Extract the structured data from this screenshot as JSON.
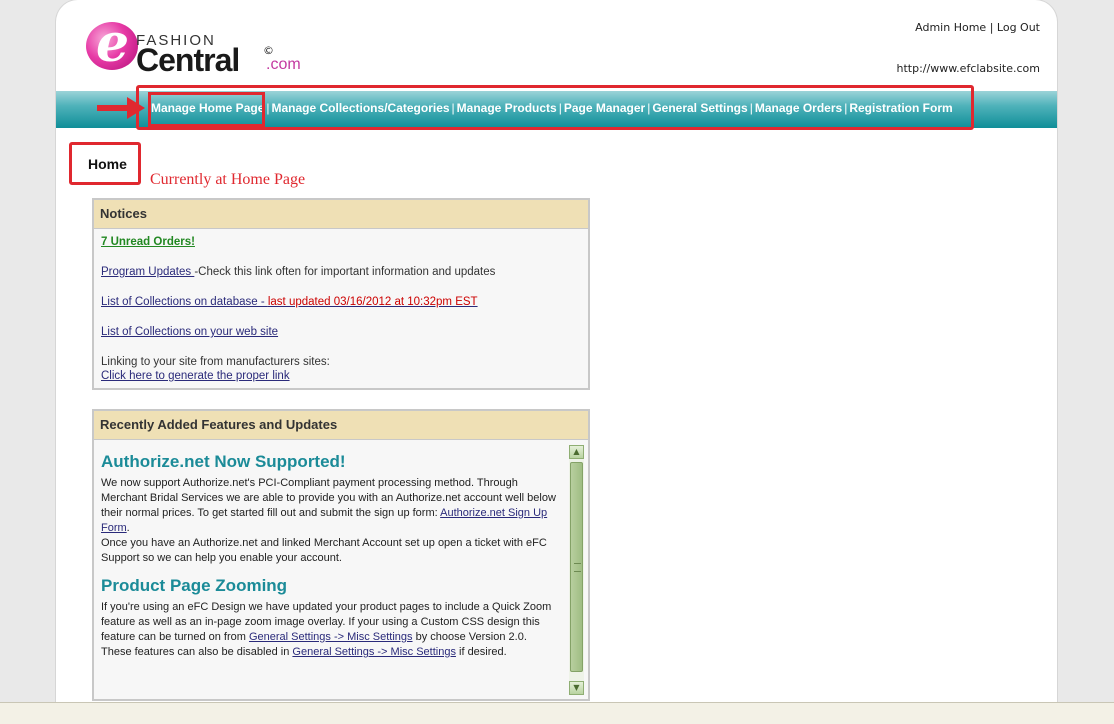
{
  "logo": {
    "letter": "e",
    "fashion": "FASHION",
    "central": "Central",
    "copyright": "©",
    "com": ".com"
  },
  "header": {
    "admin_home": "Admin Home",
    "separator": "|",
    "log_out": "Log Out",
    "site_url": "http://www.efclabsite.com"
  },
  "nav": {
    "items": [
      "Manage Home Page",
      "Manage Collections/Categories",
      "Manage Products",
      "Page Manager",
      "General Settings",
      "Manage Orders",
      "Registration Form"
    ],
    "sep": "|"
  },
  "page": {
    "title": "Home",
    "annotation": "Currently at Home Page"
  },
  "notices": {
    "heading": "Notices",
    "unread_orders": "7 Unread Orders!",
    "program_updates_link": "Program Updates ",
    "program_updates_text": "-Check this link often for important information and updates",
    "collections_db_link": "List of Collections on database - ",
    "collections_db_updated": "last updated 03/16/2012 at 10:32pm EST",
    "collections_site_link": "List of Collections on your web site",
    "linking_text": "Linking to your site from manufacturers sites:",
    "generate_link": "Click here to generate the proper link"
  },
  "features": {
    "heading": "Recently Added Features and Updates",
    "item1_title": "Authorize.net Now Supported!",
    "item1_text_a": "We now support Authorize.net's PCI-Compliant payment processing method. Through Merchant Bridal Services we are able to provide you with an Authorize.net account well below their normal prices. To get started fill out and submit the sign up form: ",
    "item1_link": "Authorize.net Sign Up Form",
    "item1_text_b": ".",
    "item1_text_c": "Once you have an Authorize.net and linked Merchant Account set up open a ticket with eFC Support so we can help you enable your account.",
    "item2_title": "Product Page Zooming",
    "item2_text_a": "If you're using an eFC Design we have updated your product pages to include a Quick Zoom feature as well as an in-page zoom image overlay. If your using a Custom CSS design this feature can be turned on from ",
    "item2_link1": "General Settings -> Misc Settings",
    "item2_text_b": " by choose Version 2.0. These features can also be disabled in ",
    "item2_link2": "General Settings -> Misc Settings",
    "item2_text_c": " if desired."
  }
}
